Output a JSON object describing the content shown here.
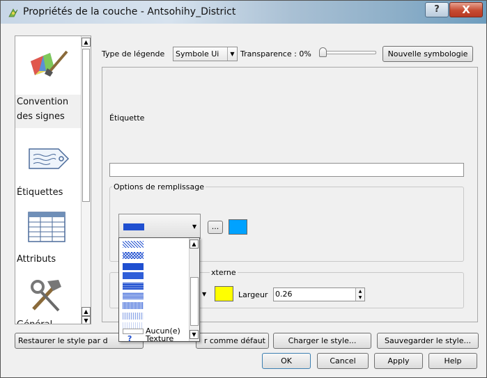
{
  "window": {
    "title": "Propriétés de la couche - Antsohihy_District",
    "help_label": "?",
    "close_label": "X"
  },
  "sidebar": {
    "items": [
      {
        "label_line1": "Convention",
        "label_line2": "des signes"
      },
      {
        "label": "Étiquettes"
      },
      {
        "label": "Attributs"
      },
      {
        "label": "Général"
      }
    ]
  },
  "toolbar": {
    "legend_type_label": "Type de légende",
    "legend_type_value": "Symbole Ui",
    "transparency_label": "Transparence : 0%",
    "new_symbology_label": "Nouvelle symbologie"
  },
  "symbol": {
    "label_heading": "Étiquette",
    "label_value": "",
    "fill_options_title": "Options de remplissage",
    "fill_color": "#00a2ff",
    "fill_pattern_color": "#1f4fd0",
    "outline_title_suffix": "xterne",
    "outline_color": "#ffff00",
    "width_label": "Largeur",
    "width_value": "0.26",
    "browse_label": "..."
  },
  "dropdown": {
    "options": [
      "Aucun(e)",
      "Texture"
    ],
    "texture_icon": "?"
  },
  "bottom": {
    "restore_label": "Restaurer le style par d",
    "save_default_label": "r comme défaut",
    "load_style_label": "Charger le style...",
    "save_style_label": "Sauvegarder le style...",
    "ok_label": "OK",
    "cancel_label": "Cancel",
    "apply_label": "Apply",
    "help_label": "Help"
  }
}
